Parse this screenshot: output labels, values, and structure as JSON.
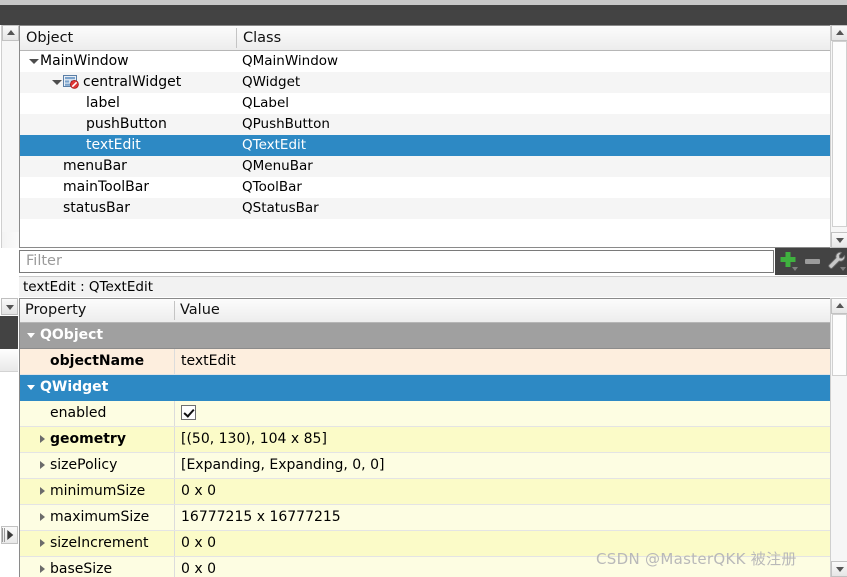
{
  "object_tree": {
    "headers": {
      "object": "Object",
      "class": "Class"
    },
    "rows": [
      {
        "name": "MainWindow",
        "class": "QMainWindow",
        "indent": 0,
        "twisty": true,
        "icon": false,
        "selected": false
      },
      {
        "name": "centralWidget",
        "class": "QWidget",
        "indent": 1,
        "twisty": true,
        "icon": true,
        "selected": false
      },
      {
        "name": "label",
        "class": "QLabel",
        "indent": 2,
        "twisty": false,
        "icon": false,
        "selected": false
      },
      {
        "name": "pushButton",
        "class": "QPushButton",
        "indent": 2,
        "twisty": false,
        "icon": false,
        "selected": false
      },
      {
        "name": "textEdit",
        "class": "QTextEdit",
        "indent": 2,
        "twisty": false,
        "icon": false,
        "selected": true
      },
      {
        "name": "menuBar",
        "class": "QMenuBar",
        "indent": 1,
        "twisty": false,
        "icon": false,
        "selected": false
      },
      {
        "name": "mainToolBar",
        "class": "QToolBar",
        "indent": 1,
        "twisty": false,
        "icon": false,
        "selected": false
      },
      {
        "name": "statusBar",
        "class": "QStatusBar",
        "indent": 1,
        "twisty": false,
        "icon": false,
        "selected": false
      }
    ]
  },
  "filter": {
    "placeholder": "Filter",
    "value": "",
    "buttons": [
      {
        "icon": "plus-icon",
        "label": ""
      },
      {
        "icon": "minus-icon",
        "label": ""
      },
      {
        "icon": "wrench-icon",
        "label": ""
      }
    ]
  },
  "selection_caption": "textEdit : QTextEdit",
  "property_editor": {
    "headers": {
      "property": "Property",
      "value": "Value"
    },
    "rows": [
      {
        "kind": "group",
        "name": "QObject",
        "value": "",
        "style": "gray",
        "expanded": true,
        "bold": true,
        "arrow": false,
        "indent": 0
      },
      {
        "kind": "property",
        "name": "objectName",
        "value": "textEdit",
        "style": "cream",
        "expanded": false,
        "bold": true,
        "arrow": false,
        "indent": 1
      },
      {
        "kind": "group",
        "name": "QWidget",
        "value": "",
        "style": "blue",
        "expanded": true,
        "bold": true,
        "arrow": false,
        "indent": 0
      },
      {
        "kind": "property",
        "name": "enabled",
        "value": "",
        "style": "yellow2",
        "expanded": false,
        "bold": false,
        "arrow": false,
        "indent": 1,
        "checkbox": true
      },
      {
        "kind": "property",
        "name": "geometry",
        "value": "[(50, 130), 104 x 85]",
        "style": "yellow",
        "expanded": false,
        "bold": true,
        "arrow": true,
        "indent": 1
      },
      {
        "kind": "property",
        "name": "sizePolicy",
        "value": "[Expanding, Expanding, 0, 0]",
        "style": "yellow2",
        "expanded": false,
        "bold": false,
        "arrow": true,
        "indent": 1
      },
      {
        "kind": "property",
        "name": "minimumSize",
        "value": "0 x 0",
        "style": "yellow",
        "expanded": false,
        "bold": false,
        "arrow": true,
        "indent": 1
      },
      {
        "kind": "property",
        "name": "maximumSize",
        "value": "16777215 x 16777215",
        "style": "yellow2",
        "expanded": false,
        "bold": false,
        "arrow": true,
        "indent": 1
      },
      {
        "kind": "property",
        "name": "sizeIncrement",
        "value": "0 x 0",
        "style": "yellow",
        "expanded": false,
        "bold": false,
        "arrow": true,
        "indent": 1
      },
      {
        "kind": "property",
        "name": "baseSize",
        "value": "0 x 0",
        "style": "yellow2",
        "expanded": false,
        "bold": false,
        "arrow": true,
        "indent": 1
      }
    ]
  },
  "watermark": "CSDN @MasterQKK 被注册",
  "colors": {
    "selection_blue": "#2d89c4",
    "group_gray": "#a0a0a0",
    "row_cream": "#fdeede",
    "row_yellow": "#fbfbc8",
    "row_yellow_alt": "#fdfde2",
    "dark_bar": "#434343",
    "plus_green": "#3fb23f"
  }
}
